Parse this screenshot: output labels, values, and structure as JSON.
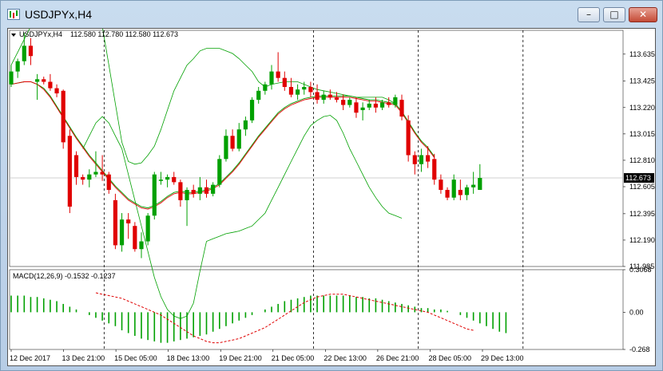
{
  "window": {
    "title": "USDJPYx,H4"
  },
  "window_buttons": {
    "minimize": "–",
    "maximize": "□",
    "close": "✕"
  },
  "chart_data": [
    {
      "type": "candlestick",
      "title": "USDJPYx,H4  112.580 112.780 112.580 112.673",
      "symbol": "USDJPYx,H4",
      "ohlc_header": [
        "112.580",
        "112.780",
        "112.580",
        "112.673"
      ],
      "ylim": [
        111.985,
        113.82
      ],
      "y_ticks": [
        "113.635",
        "113.425",
        "113.220",
        "113.015",
        "112.810",
        "112.605",
        "112.395",
        "112.190",
        "111.985"
      ],
      "current_price": "112.673",
      "x_tick_labels": [
        "12 Dec 2017",
        "13 Dec 21:00",
        "15 Dec 05:00",
        "18 Dec 13:00",
        "19 Dec 21:00",
        "21 Dec 05:00",
        "22 Dec 13:00",
        "26 Dec 21:00",
        "28 Dec 05:00",
        "29 Dec 13:00"
      ],
      "day_separators_after_tick": [
        1.5,
        5.5,
        7.5,
        9.5
      ],
      "colors": {
        "up": "#00a000",
        "down": "#e00000",
        "ma_fast": "#e00000",
        "ma_slow": "#00a000",
        "bands": "#00a000"
      },
      "candles": [
        [
          113.4,
          113.55,
          113.38,
          113.5
        ],
        [
          113.5,
          113.6,
          113.45,
          113.58
        ],
        [
          113.58,
          113.8,
          113.55,
          113.7
        ],
        [
          113.7,
          113.76,
          113.55,
          113.62
        ],
        [
          113.42,
          113.48,
          113.28,
          113.44
        ],
        [
          113.44,
          113.46,
          113.4,
          113.42
        ],
        [
          113.42,
          113.48,
          113.35,
          113.37
        ],
        [
          113.37,
          113.4,
          113.3,
          113.33
        ],
        [
          113.35,
          113.36,
          112.9,
          112.95
        ],
        [
          113.0,
          113.05,
          112.4,
          112.45
        ],
        [
          112.85,
          112.88,
          112.62,
          112.68
        ],
        [
          112.68,
          112.7,
          112.62,
          112.66
        ],
        [
          112.66,
          112.74,
          112.6,
          112.7
        ],
        [
          112.7,
          112.88,
          112.68,
          112.72
        ],
        [
          112.72,
          112.85,
          112.65,
          112.7
        ],
        [
          112.7,
          112.72,
          112.55,
          112.58
        ],
        [
          112.5,
          112.55,
          112.12,
          112.15
        ],
        [
          112.15,
          112.4,
          112.1,
          112.35
        ],
        [
          112.35,
          112.4,
          112.2,
          112.32
        ],
        [
          112.3,
          112.33,
          112.1,
          112.12
        ],
        [
          112.12,
          112.25,
          112.05,
          112.18
        ],
        [
          112.18,
          112.4,
          112.15,
          112.38
        ],
        [
          112.38,
          112.72,
          112.35,
          112.7
        ],
        [
          112.65,
          112.72,
          112.62,
          112.66
        ],
        [
          112.66,
          112.7,
          112.6,
          112.68
        ],
        [
          112.68,
          112.72,
          112.62,
          112.64
        ],
        [
          112.64,
          112.66,
          112.45,
          112.5
        ],
        [
          112.5,
          112.6,
          112.3,
          112.58
        ],
        [
          112.58,
          112.62,
          112.52,
          112.55
        ],
        [
          112.55,
          112.68,
          112.5,
          112.6
        ],
        [
          112.6,
          112.66,
          112.52,
          112.55
        ],
        [
          112.55,
          112.64,
          112.53,
          112.62
        ],
        [
          112.62,
          112.85,
          112.6,
          112.82
        ],
        [
          112.82,
          113.05,
          112.8,
          113.0
        ],
        [
          113.0,
          113.05,
          112.88,
          112.9
        ],
        [
          112.9,
          113.1,
          112.88,
          113.05
        ],
        [
          113.05,
          113.15,
          113.0,
          113.12
        ],
        [
          113.12,
          113.3,
          113.1,
          113.28
        ],
        [
          113.28,
          113.38,
          113.25,
          113.35
        ],
        [
          113.35,
          113.42,
          113.32,
          113.4
        ],
        [
          113.4,
          113.55,
          113.36,
          113.5
        ],
        [
          113.5,
          113.65,
          113.42,
          113.45
        ],
        [
          113.45,
          113.5,
          113.35,
          113.38
        ],
        [
          113.38,
          113.45,
          113.3,
          113.32
        ],
        [
          113.32,
          113.4,
          113.28,
          113.36
        ],
        [
          113.36,
          113.42,
          113.32,
          113.38
        ],
        [
          113.38,
          113.42,
          113.3,
          113.34
        ],
        [
          113.34,
          113.4,
          113.25,
          113.28
        ],
        [
          113.28,
          113.35,
          113.25,
          113.32
        ],
        [
          113.32,
          113.36,
          113.28,
          113.3
        ],
        [
          113.3,
          113.34,
          113.26,
          113.28
        ],
        [
          113.28,
          113.32,
          113.2,
          113.24
        ],
        [
          113.24,
          113.3,
          113.22,
          113.28
        ],
        [
          113.26,
          113.3,
          113.14,
          113.18
        ],
        [
          113.2,
          113.26,
          113.12,
          113.22
        ],
        [
          113.22,
          113.28,
          113.2,
          113.25
        ],
        [
          113.25,
          113.3,
          113.18,
          113.22
        ],
        [
          113.22,
          113.28,
          113.2,
          113.26
        ],
        [
          113.26,
          113.3,
          113.22,
          113.24
        ],
        [
          113.24,
          113.32,
          113.22,
          113.3
        ],
        [
          113.28,
          113.32,
          113.12,
          113.15
        ],
        [
          113.12,
          113.16,
          112.8,
          112.85
        ],
        [
          112.85,
          112.88,
          112.7,
          112.78
        ],
        [
          112.78,
          112.9,
          112.72,
          112.85
        ],
        [
          112.85,
          112.92,
          112.75,
          112.8
        ],
        [
          112.82,
          112.86,
          112.62,
          112.66
        ],
        [
          112.66,
          112.7,
          112.55,
          112.58
        ],
        [
          112.58,
          112.6,
          112.5,
          112.52
        ],
        [
          112.52,
          112.7,
          112.5,
          112.66
        ],
        [
          112.58,
          112.66,
          112.5,
          112.54
        ],
        [
          112.54,
          112.62,
          112.5,
          112.6
        ],
        [
          112.6,
          112.72,
          112.55,
          112.62
        ],
        [
          112.58,
          112.78,
          112.58,
          112.673
        ]
      ],
      "ma_fast": [
        113.4,
        113.41,
        113.42,
        113.42,
        113.4,
        113.36,
        113.3,
        113.22,
        113.14,
        113.06,
        112.98,
        112.91,
        112.84,
        112.78,
        112.72,
        112.66,
        112.6,
        112.55,
        112.5,
        112.47,
        112.44,
        112.43,
        112.45,
        112.48,
        112.52,
        112.55,
        112.56,
        112.55,
        112.55,
        112.56,
        112.57,
        112.59,
        112.62,
        112.67,
        112.72,
        112.78,
        112.85,
        112.92,
        112.99,
        113.05,
        113.11,
        113.17,
        113.21,
        113.24,
        113.26,
        113.28,
        113.29,
        113.3,
        113.3,
        113.3,
        113.3,
        113.3,
        113.3,
        113.29,
        113.28,
        113.27,
        113.27,
        113.26,
        113.25,
        113.24,
        113.18,
        113.1,
        113.02,
        112.95,
        112.9,
        112.83
      ],
      "ma_slow": [
        113.4,
        113.41,
        113.42,
        113.42,
        113.4,
        113.37,
        113.31,
        113.23,
        113.15,
        113.07,
        112.99,
        112.92,
        112.85,
        112.79,
        112.73,
        112.67,
        112.61,
        112.56,
        112.51,
        112.48,
        112.45,
        112.44,
        112.46,
        112.49,
        112.53,
        112.56,
        112.57,
        112.56,
        112.56,
        112.57,
        112.58,
        112.6,
        112.63,
        112.68,
        112.73,
        112.79,
        112.86,
        112.93,
        113.0,
        113.06,
        113.12,
        113.18,
        113.22,
        113.25,
        113.27,
        113.29,
        113.3,
        113.31,
        113.31,
        113.31,
        113.31,
        113.31,
        113.31,
        113.3,
        113.29,
        113.28,
        113.28,
        113.27,
        113.26,
        113.25,
        113.19,
        113.11,
        113.03,
        112.96,
        112.91,
        112.84
      ],
      "band_upper": [
        113.55,
        113.65,
        113.75,
        113.85,
        113.95,
        114.1,
        114.25,
        114.4,
        114.5,
        114.55,
        114.5,
        114.4,
        114.25,
        114.05,
        113.85,
        113.55,
        113.25,
        112.95,
        112.8,
        112.78,
        112.79,
        112.85,
        112.92,
        113.05,
        113.2,
        113.35,
        113.45,
        113.55,
        113.6,
        113.66,
        113.68,
        113.68,
        113.68,
        113.66,
        113.64,
        113.6,
        113.55,
        113.5,
        113.42,
        113.38,
        113.4,
        113.41,
        113.42,
        113.42,
        113.42,
        113.4,
        113.38,
        113.36,
        113.35,
        113.34,
        113.33,
        113.32,
        113.31,
        113.3,
        113.3,
        113.3,
        113.3,
        113.3,
        113.28,
        113.25
      ],
      "band_lower": [
        112.9,
        113.0,
        113.1,
        113.15,
        113.1,
        113.0,
        112.9,
        112.7,
        112.5,
        112.3,
        112.1,
        111.9,
        111.75,
        111.65,
        111.6,
        111.58,
        111.6,
        111.7,
        111.95,
        112.18,
        112.2,
        112.22,
        112.24,
        112.25,
        112.26,
        112.28,
        112.3,
        112.35,
        112.4,
        112.5,
        112.6,
        112.7,
        112.8,
        112.9,
        113.0,
        113.08,
        113.12,
        113.15,
        113.16,
        113.12,
        113.02,
        112.9,
        112.8,
        112.7,
        112.6,
        112.52,
        112.45,
        112.4,
        112.38,
        112.36
      ]
    },
    {
      "type": "bar",
      "title": "MACD(12,26,9) -0.1532 -0.1237",
      "indicator": "MACD(12,26,9)",
      "readings": [
        "-0.1532",
        "-0.1237"
      ],
      "ylim": [
        -0.268,
        0.3068
      ],
      "y_ticks": [
        "0.3068",
        "0.00",
        "-0.268"
      ],
      "histogram": [
        0.12,
        0.12,
        0.12,
        0.11,
        0.11,
        0.1,
        0.09,
        0.08,
        0.06,
        0.04,
        0.02,
        0.0,
        -0.02,
        -0.04,
        -0.06,
        -0.08,
        -0.1,
        -0.13,
        -0.15,
        -0.17,
        -0.19,
        -0.2,
        -0.21,
        -0.22,
        -0.22,
        -0.21,
        -0.2,
        -0.19,
        -0.18,
        -0.17,
        -0.16,
        -0.14,
        -0.12,
        -0.1,
        -0.08,
        -0.06,
        -0.04,
        -0.02,
        0.0,
        0.02,
        0.04,
        0.06,
        0.08,
        0.09,
        0.1,
        0.11,
        0.12,
        0.12,
        0.12,
        0.12,
        0.12,
        0.12,
        0.12,
        0.11,
        0.11,
        0.1,
        0.1,
        0.09,
        0.08,
        0.07,
        0.06,
        0.05,
        0.04,
        0.03,
        0.03,
        0.02,
        0.02,
        0.01,
        0.0,
        -0.02,
        -0.04,
        -0.06,
        -0.08,
        -0.1,
        -0.12,
        -0.14,
        -0.15
      ],
      "signal": [
        0.14,
        0.13,
        0.12,
        0.11,
        0.1,
        0.08,
        0.06,
        0.04,
        0.02,
        0.0,
        -0.02,
        -0.05,
        -0.08,
        -0.11,
        -0.14,
        -0.17,
        -0.19,
        -0.21,
        -0.22,
        -0.22,
        -0.21,
        -0.2,
        -0.19,
        -0.17,
        -0.15,
        -0.13,
        -0.11,
        -0.08,
        -0.05,
        -0.02,
        0.01,
        0.04,
        0.07,
        0.09,
        0.11,
        0.12,
        0.13,
        0.13,
        0.13,
        0.12,
        0.11,
        0.1,
        0.09,
        0.08,
        0.07,
        0.06,
        0.05,
        0.04,
        0.03,
        0.02,
        0.01,
        0.0,
        -0.02,
        -0.04,
        -0.06,
        -0.08,
        -0.1,
        -0.12,
        -0.13
      ],
      "colors": {
        "histogram": "#00a000",
        "signal": "#e00000"
      }
    }
  ]
}
